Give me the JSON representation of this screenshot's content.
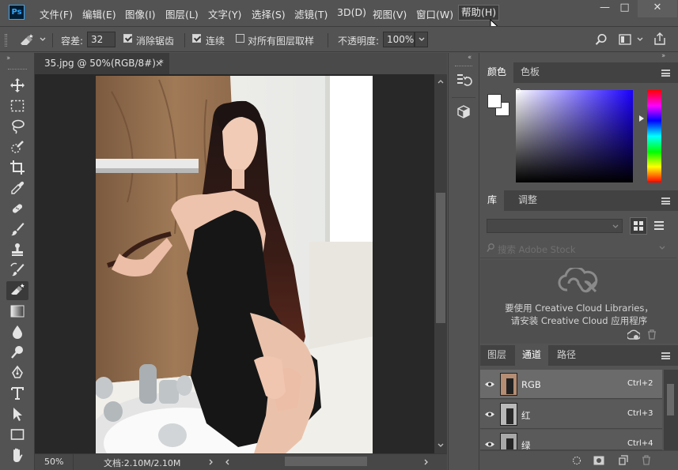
{
  "app": {
    "logo": "Ps"
  },
  "menu": [
    "文件(F)",
    "编辑(E)",
    "图像(I)",
    "图层(L)",
    "文字(Y)",
    "选择(S)",
    "滤镜(T)",
    "3D(D)",
    "视图(V)",
    "窗口(W)",
    "帮助(H)"
  ],
  "window_controls": {
    "minimize": "—",
    "maximize": "□",
    "close": "✕"
  },
  "options": {
    "tolerance_label": "容差:",
    "tolerance_value": "32",
    "anti_alias_label": "消除锯齿",
    "anti_alias_checked": true,
    "contiguous_label": "连续",
    "contiguous_checked": true,
    "all_layers_label": "对所有图层取样",
    "all_layers_checked": false,
    "opacity_label": "不透明度:",
    "opacity_value": "100%"
  },
  "toolbar_icons": [
    "move-icon",
    "marquee-icon",
    "lasso-icon",
    "quick-select-icon",
    "crop-icon",
    "eyedropper-icon",
    "healing-icon",
    "brush-icon",
    "stamp-icon",
    "history-brush-icon",
    "eraser-icon",
    "gradient-icon",
    "blur-icon",
    "dodge-icon",
    "pen-icon",
    "type-icon",
    "path-select-icon",
    "shape-icon",
    "hand-icon"
  ],
  "document": {
    "tab_title": "35.jpg @ 50%(RGB/8#) *",
    "tab_close": "×",
    "zoom": "50%",
    "doc_info": "文档:2.10M/2.10M"
  },
  "color_panel": {
    "tabs": [
      "颜色",
      "色板"
    ],
    "active_tab": "颜色",
    "hue_color": "#1a00ff"
  },
  "library_panel": {
    "tabs": [
      "库",
      "调整"
    ],
    "active_tab": "库",
    "search_placeholder": "搜索 Adobe Stock",
    "message_line1": "要使用 Creative Cloud Libraries，",
    "message_line2": "请安装 Creative Cloud 应用程序"
  },
  "channels_panel": {
    "tabs": [
      "图层",
      "通道",
      "路径"
    ],
    "active_tab": "通道",
    "rows": [
      {
        "name": "RGB",
        "shortcut": "Ctrl+2"
      },
      {
        "name": "红",
        "shortcut": "Ctrl+3"
      },
      {
        "name": "绿",
        "shortcut": "Ctrl+4"
      }
    ]
  },
  "colors": {
    "panel_bg": "#535353",
    "canvas_bg": "#282828",
    "accent": "#31a8ff"
  }
}
